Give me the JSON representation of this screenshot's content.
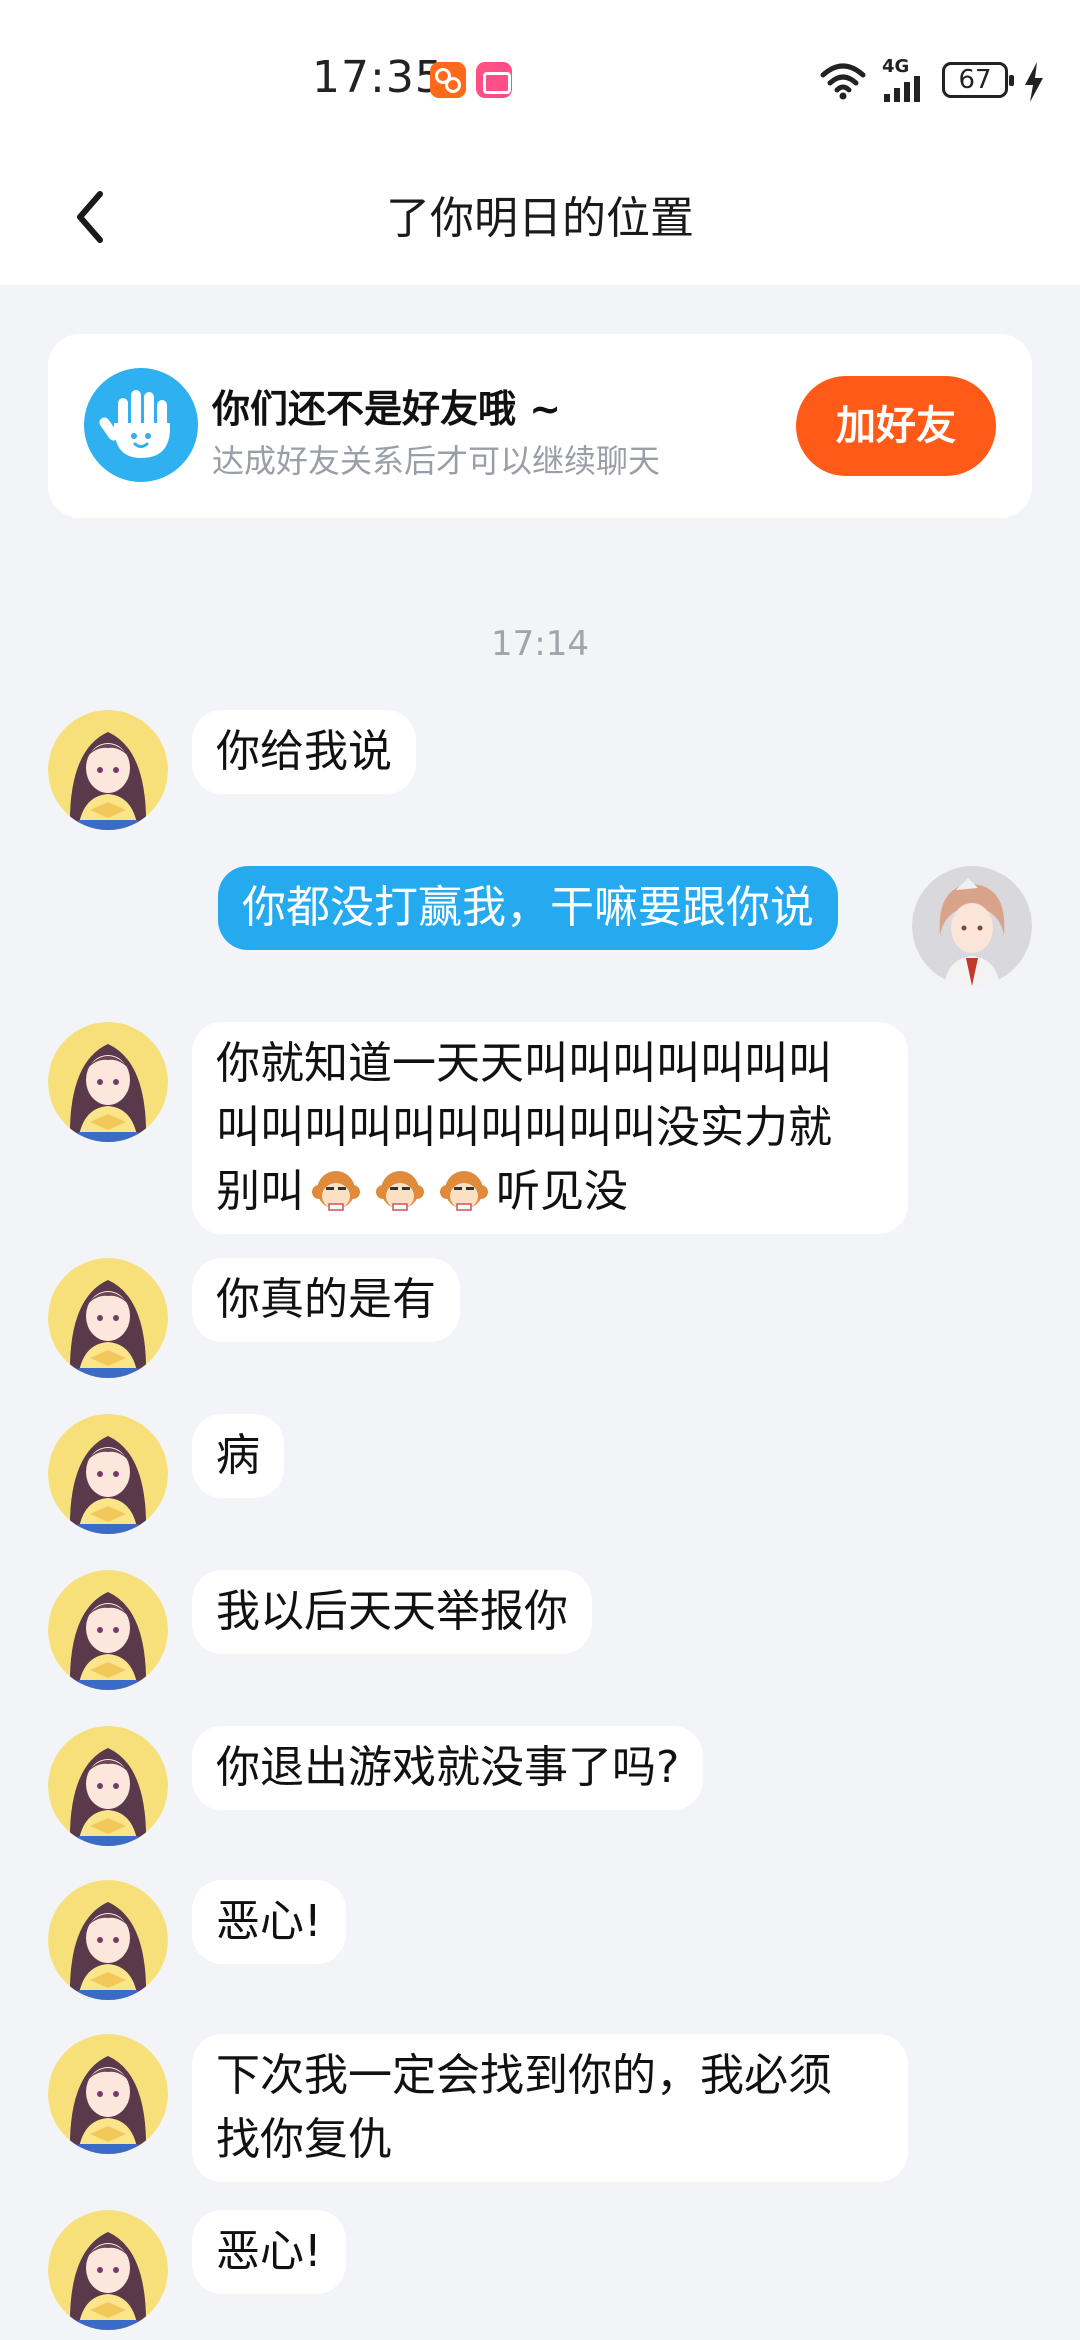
{
  "status_bar": {
    "time": "17:35",
    "network": "4G",
    "battery": "67",
    "icons": [
      "app-notification-icon",
      "app-notification-icon",
      "wifi-icon",
      "signal-icon",
      "battery-icon",
      "charging-icon"
    ]
  },
  "header": {
    "title": "了你明日的位置",
    "back_icon": "back-arrow-icon"
  },
  "friend_card": {
    "title": "你们还不是好友哦 ~",
    "subtitle": "达成好友关系后才可以继续聊天",
    "button": "加好友",
    "icon": "wave-hand-icon"
  },
  "timestamp": "17:14",
  "messages": [
    {
      "side": "in",
      "text": "你给我说"
    },
    {
      "side": "out",
      "text": "你都没打赢我，干嘛要跟你说"
    },
    {
      "side": "in",
      "text_lines": [
        "你就知道一天天叫叫叫叫叫叫叫",
        "叫叫叫叫叫叫叫叫叫叫没实力就"
      ],
      "line3_before": "别叫",
      "line3_after": "听见没",
      "emoji": "monkey-emoji"
    },
    {
      "side": "in",
      "text": "你真的是有"
    },
    {
      "side": "in",
      "text": "病"
    },
    {
      "side": "in",
      "text": "我以后天天举报你"
    },
    {
      "side": "in",
      "text": "你退出游戏就没事了吗?"
    },
    {
      "side": "in",
      "text": "恶心!"
    },
    {
      "side": "in",
      "text_lines": [
        "下次我一定会找到你的，我必须",
        "找你复仇"
      ]
    },
    {
      "side": "in",
      "text": "恶心!"
    }
  ],
  "colors": {
    "accent_blue": "#25aaf0",
    "add_button": "#ff5a17",
    "background": "#f2f4f7"
  }
}
